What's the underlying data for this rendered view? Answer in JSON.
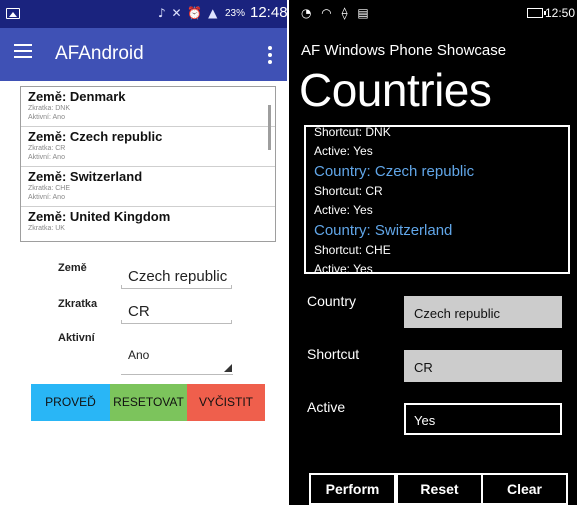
{
  "android": {
    "status_time": "12:48",
    "status_battery": "23%",
    "app_title": "AFAndroid",
    "list": [
      {
        "title": "Země: Denmark",
        "shortcut": "Zkratka: DNK",
        "active": "Aktivní: Ano"
      },
      {
        "title": "Země: Czech republic",
        "shortcut": "Zkratka: CR",
        "active": "Aktivní: Ano"
      },
      {
        "title": "Země: Switzerland",
        "shortcut": "Zkratka: CHE",
        "active": "Aktivní: Ano"
      },
      {
        "title": "Země: United Kingdom",
        "shortcut": "Zkratka: UK",
        "active": ""
      }
    ],
    "form": {
      "country_label": "Země",
      "country_value": "Czech republic",
      "shortcut_label": "Zkratka",
      "shortcut_value": "CR",
      "active_label": "Aktivní",
      "active_value": "Ano"
    },
    "buttons": {
      "perform": "PROVEĎ",
      "reset": "RESETOVAT",
      "clear": "VYČISTIT"
    },
    "colors": {
      "status_bar": "#1a237e",
      "app_bar": "#3f51b5",
      "perform_button": "#29b6f6",
      "reset_button": "#7cc45c",
      "clear_button": "#ef5f4c"
    }
  },
  "wp": {
    "status_time": "12:50",
    "app_title": "AF Windows Phone Showcase",
    "page_title": "Countries",
    "list_lines": [
      {
        "kind": "line",
        "text": "Shortcut: DNK"
      },
      {
        "kind": "line",
        "text": "Active: Yes"
      },
      {
        "kind": "head",
        "text": "Country: Czech republic"
      },
      {
        "kind": "line",
        "text": "Shortcut: CR"
      },
      {
        "kind": "line",
        "text": "Active: Yes"
      },
      {
        "kind": "head",
        "text": "Country: Switzerland"
      },
      {
        "kind": "line",
        "text": "Shortcut: CHE"
      },
      {
        "kind": "line",
        "text": "Active: Yes"
      }
    ],
    "form": {
      "country_label": "Country",
      "country_value": "Czech republic",
      "shortcut_label": "Shortcut",
      "shortcut_value": "CR",
      "active_label": "Active",
      "active_value": "Yes"
    },
    "buttons": {
      "perform": "Perform",
      "reset": "Reset",
      "clear": "Clear"
    },
    "colors": {
      "heading_accent": "#61a6e8",
      "field_fill": "#cccccc"
    }
  }
}
